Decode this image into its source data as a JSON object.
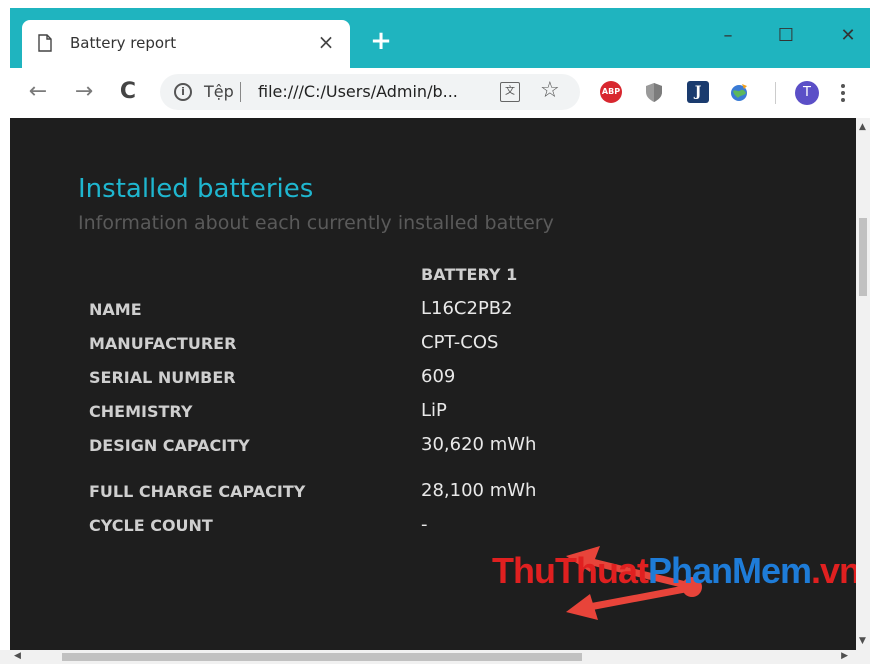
{
  "browser": {
    "tab_title": "Battery report",
    "tab_close": "×",
    "new_tab": "+",
    "window_controls": {
      "minimize": "–",
      "maximize": "☐",
      "close": "✕"
    },
    "nav": {
      "back": "←",
      "forward": "→",
      "reload": "C"
    },
    "omnibox": {
      "info": "i",
      "scheme_label": "Tệp",
      "url": "file:///C:/Users/Admin/b..."
    },
    "extensions": {
      "abp_label": "ABP",
      "jd_label": "J"
    },
    "avatar_initial": "T",
    "accent_color": "#1fb4bf"
  },
  "report": {
    "heading": "Installed batteries",
    "subheading": "Information about each currently installed battery",
    "column_header": "BATTERY 1",
    "rows": [
      {
        "label": "NAME",
        "value": "L16C2PB2"
      },
      {
        "label": "MANUFACTURER",
        "value": "CPT-COS"
      },
      {
        "label": "SERIAL NUMBER",
        "value": "609"
      },
      {
        "label": "CHEMISTRY",
        "value": "LiP"
      },
      {
        "label": "DESIGN CAPACITY",
        "value": "30,620 mWh"
      },
      {
        "label": "FULL CHARGE CAPACITY",
        "value": "28,100 mWh"
      },
      {
        "label": "CYCLE COUNT",
        "value": "-"
      }
    ]
  },
  "watermark": {
    "part1": "ThuThuat",
    "part2": "PhanMem",
    "part3": ".vn"
  },
  "annotation_color": "#e8443a"
}
